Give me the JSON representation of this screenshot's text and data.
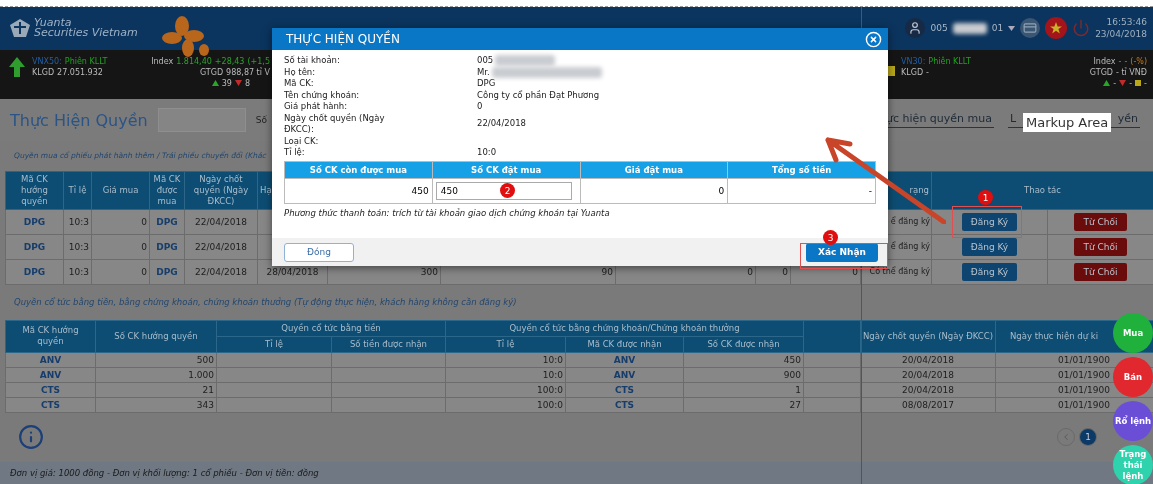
{
  "header": {
    "logo_top": "Yuanta",
    "logo_bottom": "Securities Vietnam",
    "account_start": "005",
    "account_end": "01",
    "time": "16:53:46",
    "date": "23/04/2018"
  },
  "tickers": [
    {
      "exchange": "VNX50:",
      "session": "Phiên KLLT",
      "volume_label": "KLGD",
      "volume": "27.051.932",
      "index_label": "Index",
      "index_value": "1.814,40",
      "index_change": "+28,43",
      "index_pct": "(+1,5",
      "value_label": "GTGD",
      "value": "988,87 tỉ V",
      "up": "39",
      "down": "8"
    },
    {
      "exchange": "VN30:",
      "session": "Phiên KLLT",
      "volume_label": "KLGD",
      "volume": "-",
      "index_label": "Index",
      "index_value": "-",
      "index_change": "-",
      "index_pct": "(-%)",
      "value_label": "GTGD",
      "value": "- tỉ VNĐ",
      "up": "-",
      "down": "-",
      "flat": "-"
    }
  ],
  "title_bar": {
    "title": "Thực Hiện Quyền",
    "field_label": "Số",
    "tabs": [
      {
        "parts": [
          "ực hiện quyền mua"
        ]
      },
      {
        "parts": [
          "L",
          "yền"
        ]
      }
    ]
  },
  "section_1": "Quyền mua cổ phiếu phát hành thêm / Trái phiếu chuyển đổi (Khác",
  "table_1": {
    "columns_left": [
      "Mã CK hướng quyền",
      "Tỉ lệ",
      "Giá mua",
      "Mã CK được mua",
      "Ngày chốt quyền (Ngày ĐKCC)",
      "Hạ"
    ],
    "columns_right": [
      "rạng",
      "Thao tác"
    ],
    "rows": [
      {
        "code": "DPG",
        "ratio": "10:3",
        "price": "0",
        "target_code": "DPG",
        "record_date": "22/04/2018",
        "status": "ể đăng ký",
        "actions": [
          "Đăng Ký",
          "Từ Chối"
        ]
      },
      {
        "code": "DPG",
        "ratio": "10:3",
        "price": "0",
        "target_code": "DPG",
        "record_date": "22/04/2018",
        "status": "ể đăng ký",
        "actions": [
          "Đăng Ký",
          "Từ Chối"
        ]
      },
      {
        "code": "DPG",
        "ratio": "10:3",
        "price": "0",
        "target_code": "DPG",
        "record_date": "22/04/2018",
        "middle": [
          "28/04/2018",
          "300",
          "90",
          "0",
          "0",
          "0"
        ],
        "status": "Có thể đăng ký",
        "actions": [
          "Đăng Ký",
          "Từ Chối"
        ]
      }
    ]
  },
  "section_2": "Quyền cổ tức bằng tiền, bằng chứng khoán, chứng khoán thưởng (Tự động thực hiện, khách hàng không cần đăng ký)",
  "table_2": {
    "code_header": "Mã CK hướng quyền",
    "qty_header": "Số CK hướng quyền",
    "cash_group": "Quyền cổ tức bằng tiền",
    "cash_columns": [
      "Tỉ lệ",
      "Số tiền được nhận"
    ],
    "stock_group": "Quyền cổ tức bằng chứng khoán/Chứng khoán thưởng",
    "stock_columns": [
      "Tỉ lệ",
      "Mã CK được nhận",
      "Số CK được nhận"
    ],
    "record_header": "Ngày chốt quyền (Ngày ĐKCC)",
    "exec_header": "Ngày thực hiện dự ki",
    "rows": [
      {
        "code": "ANV",
        "qty": "500",
        "stock_ratio": "10:0",
        "stock_code": "ANV",
        "stock_qty": "450",
        "record_date": "20/04/2018",
        "exec_date": "01/01/1900"
      },
      {
        "code": "ANV",
        "qty": "1.000",
        "stock_ratio": "10:0",
        "stock_code": "ANV",
        "stock_qty": "900",
        "record_date": "20/04/2018",
        "exec_date": "01/01/1900"
      },
      {
        "code": "CTS",
        "qty": "21",
        "stock_ratio": "100:0",
        "stock_code": "CTS",
        "stock_qty": "1",
        "record_date": "20/04/2018",
        "exec_date": "01/01/1900"
      },
      {
        "code": "CTS",
        "qty": "343",
        "stock_ratio": "100:0",
        "stock_code": "CTS",
        "stock_qty": "27",
        "record_date": "08/08/2017",
        "exec_date": "01/01/1900"
      }
    ]
  },
  "pagination": {
    "pages": [
      {
        "label": "1",
        "selected": true
      }
    ]
  },
  "footer": "Đơn vị giá: 1000 đồng - Đơn vị khối lượng: 1 cổ phiếu - Đơn vị tiền: đồng",
  "quick_actions": [
    {
      "label": "Mua",
      "color": "#20b03c"
    },
    {
      "label": "Bán",
      "color": "#e0282e"
    },
    {
      "label": "Rổ lệnh",
      "color": "#6a4fd6"
    },
    {
      "label": "Trạng thái lệnh",
      "color": "#2ed3ad"
    }
  ],
  "dialog": {
    "title": "THỰC HIỆN QUYỀN",
    "fields": [
      {
        "label": "Số tài khoản:",
        "value": "005",
        "redacted": true
      },
      {
        "label": "Họ tên:",
        "value": "Mr.",
        "redacted": true
      },
      {
        "label": "Mã CK:",
        "value": "DPG",
        "redacted": false
      },
      {
        "label": "Tên chứng khoán:",
        "value": "Công ty cổ phần Đạt Phương",
        "redacted": false
      },
      {
        "label": "Giá phát hành:",
        "value": "0",
        "redacted": false
      },
      {
        "label": "Ngày chốt quyền (Ngày ĐKCC):",
        "value": "22/04/2018",
        "redacted": false
      },
      {
        "label": "Loại CK:",
        "redacted": false
      },
      {
        "label": "Tỉ lệ:",
        "value": "10:0",
        "redacted": false
      }
    ],
    "columns": [
      "Số CK còn được mua",
      "Số CK đặt mua",
      "Giá đặt mua",
      "Tổng số tiền"
    ],
    "remaining": "450",
    "order_qty": "450",
    "price": "0",
    "total": "-",
    "note": "Phương thức thanh toán: trích từ tài khoản giao dịch chứng khoán tại Yuanta",
    "buttons": [
      {
        "label": "Đóng",
        "kind": "secondary"
      },
      {
        "label": "Xác Nhận",
        "kind": "primary"
      }
    ]
  },
  "annotations": {
    "markers": [
      "1",
      "2",
      "3"
    ],
    "label": "Markup Area"
  }
}
